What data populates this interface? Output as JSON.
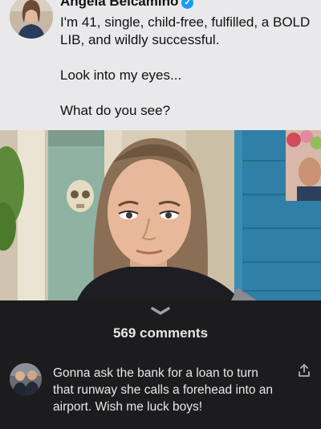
{
  "post": {
    "author": "Angela Belcamino",
    "verified_icon": "verified-badge-icon",
    "lines": [
      "I'm 41, single, child-free, fulfilled, a BOLD LIB, and wildly successful.",
      "Look into my eyes...",
      "What do you see?"
    ]
  },
  "comments": {
    "count_label": "569 comments",
    "items": [
      {
        "text": "Gonna ask the bank for a loan to turn that runway she calls a forehead into an airport. Wish me luck boys!"
      }
    ]
  },
  "colors": {
    "post_bg": "#e9e9eb",
    "panel_bg": "#1c1c1e",
    "verified": "#1d9bf0"
  }
}
